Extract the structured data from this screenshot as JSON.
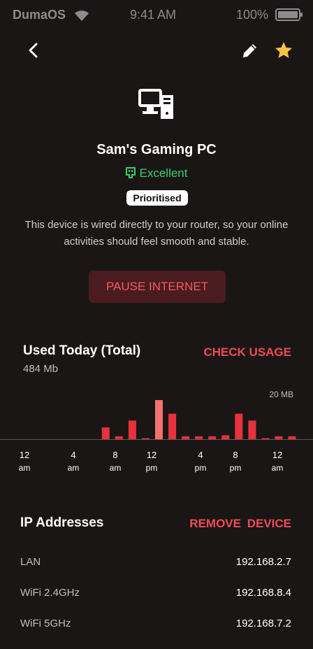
{
  "status_bar": {
    "carrier": "DumaOS",
    "time": "9:41 AM",
    "battery": "100%"
  },
  "icons": {
    "back": "back-icon",
    "edit": "pencil-icon",
    "favorite": "star-icon",
    "device": "desktop-pc-icon",
    "connection": "ethernet-plug-icon"
  },
  "colors": {
    "background": "#1b1616",
    "accent": "#ef4b57",
    "good": "#34d36a",
    "favorite": "#f5c542",
    "bar": "#e5323e",
    "bar_highlight": "#f2706f"
  },
  "device": {
    "name": "Sam's Gaming PC",
    "status": "Excellent",
    "badge": "Prioritised",
    "description": "This device is wired directly to your router, so your online activities should feel smooth and stable."
  },
  "actions": {
    "pause": "PAUSE INTERNET",
    "check_usage": "CHECK USAGE",
    "remove": "REMOVE  DEVICE"
  },
  "usage": {
    "title": "Used Today (Total)",
    "total": "484 Mb",
    "scale_label": "20 MB"
  },
  "chart_data": {
    "type": "bar",
    "ylim": [
      0,
      20
    ],
    "y_unit": "MB",
    "values": [
      0,
      0,
      0,
      0,
      0,
      0,
      6,
      1.5,
      9.5,
      0.5,
      20,
      13,
      1.5,
      1.5,
      1.5,
      2,
      13,
      9.5,
      0.5,
      1.5,
      1.5
    ],
    "highlight_index": 10,
    "ticks": [
      {
        "hour": "12",
        "period": "am",
        "pos": 0
      },
      {
        "hour": "4",
        "period": "am",
        "pos": 4
      },
      {
        "hour": "8",
        "period": "am",
        "pos": 8
      },
      {
        "hour": "12",
        "period": "pm",
        "pos": 12
      },
      {
        "hour": "4",
        "period": "pm",
        "pos": 16
      },
      {
        "hour": "8",
        "period": "pm",
        "pos": 20
      },
      {
        "hour": "12",
        "period": "am",
        "pos": 24
      }
    ]
  },
  "ip": {
    "title": "IP Addresses",
    "rows": [
      {
        "label": "LAN",
        "value": "192.168.2.7"
      },
      {
        "label": "WiFi 2.4GHz",
        "value": "192.168.8.4"
      },
      {
        "label": "WiFi 5GHz",
        "value": "192.168.7.2"
      }
    ]
  }
}
